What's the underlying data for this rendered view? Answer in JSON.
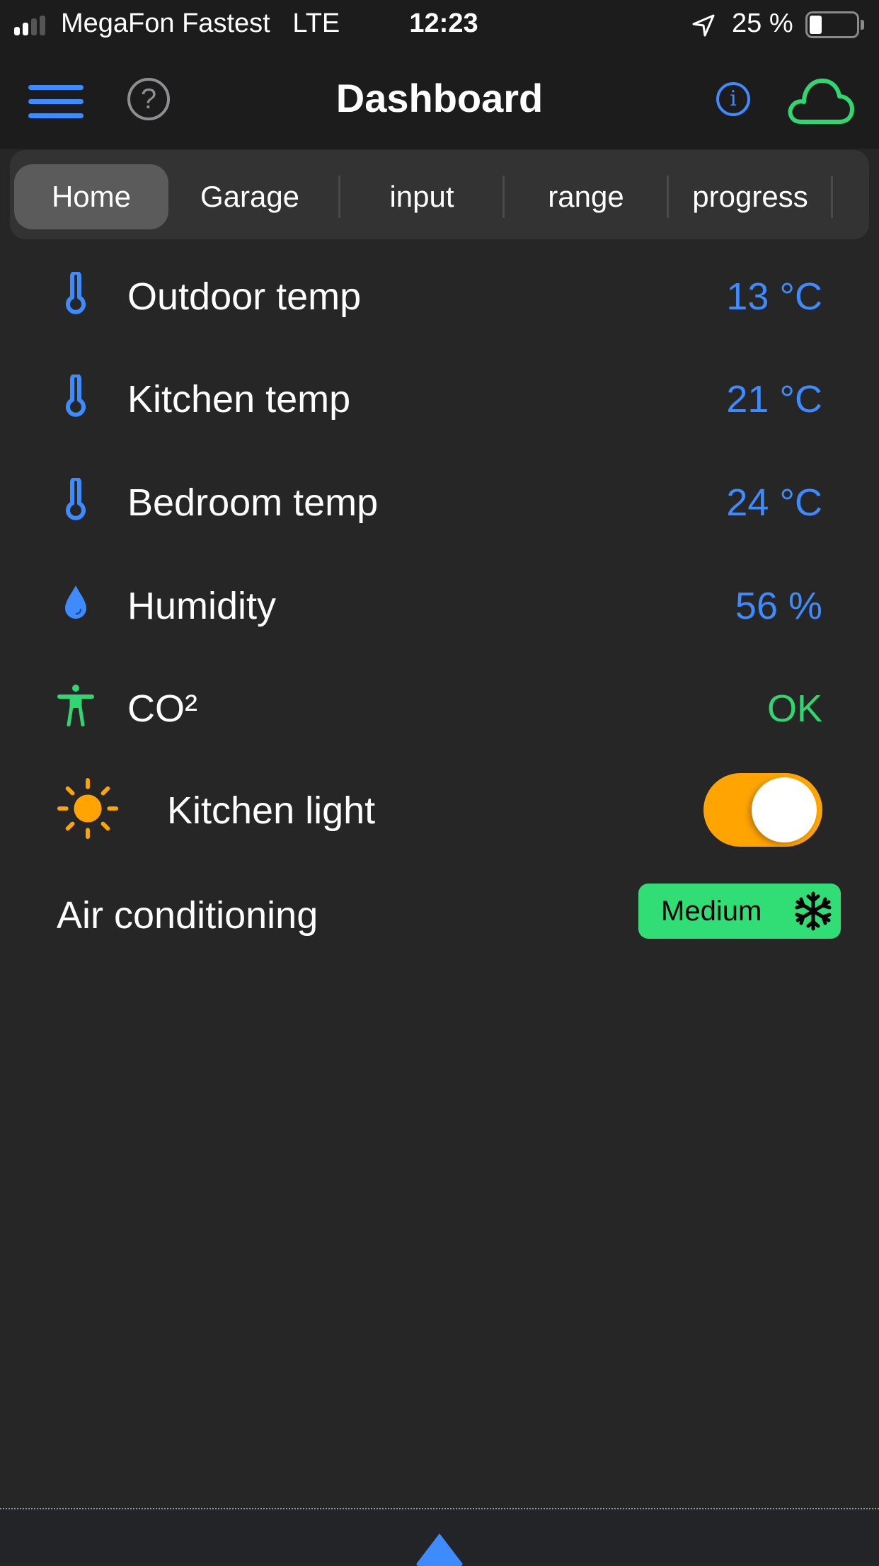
{
  "status_bar": {
    "carrier": "MegaFon Fastest",
    "network": "LTE",
    "time": "12:23",
    "battery_percent_label": "25 %",
    "battery_level": 0.25,
    "signal_bars": 2,
    "icons": [
      "signal-icon",
      "location-arrow-icon",
      "battery-icon"
    ]
  },
  "nav": {
    "title": "Dashboard",
    "help_glyph": "?",
    "info_glyph": "i",
    "icons": [
      "menu-icon",
      "help-icon",
      "info-icon",
      "cloud-icon"
    ]
  },
  "tabs": [
    {
      "label": "Home",
      "active": true
    },
    {
      "label": "Garage",
      "active": false
    },
    {
      "label": "input",
      "active": false
    },
    {
      "label": "range",
      "active": false
    },
    {
      "label": "progress",
      "active": false
    }
  ],
  "rows": [
    {
      "icon": "thermometer-icon",
      "label": "Outdoor temp",
      "value": "13 °C"
    },
    {
      "icon": "thermometer-icon",
      "label": "Kitchen temp",
      "value": "21 °C"
    },
    {
      "icon": "thermometer-icon",
      "label": "Bedroom temp",
      "value": "24 °C"
    },
    {
      "icon": "droplet-icon",
      "label": "Humidity",
      "value": "56 %"
    },
    {
      "icon": "person-icon",
      "label": "CO²",
      "value": "OK"
    }
  ],
  "kitchen_light": {
    "icon": "sun-icon",
    "label": "Kitchen light",
    "on": true
  },
  "air_conditioning": {
    "label": "Air conditioning",
    "mode": "Medium",
    "icon": "snowflake-icon"
  },
  "colors": {
    "accent_blue": "#3d8bfd",
    "ok_green": "#30d770",
    "toggle_orange": "#ffa400",
    "button_green": "#30de75",
    "background": "#262626",
    "header": "#1c1c1c"
  },
  "bottom": {
    "icon": "triangle-up-icon"
  }
}
